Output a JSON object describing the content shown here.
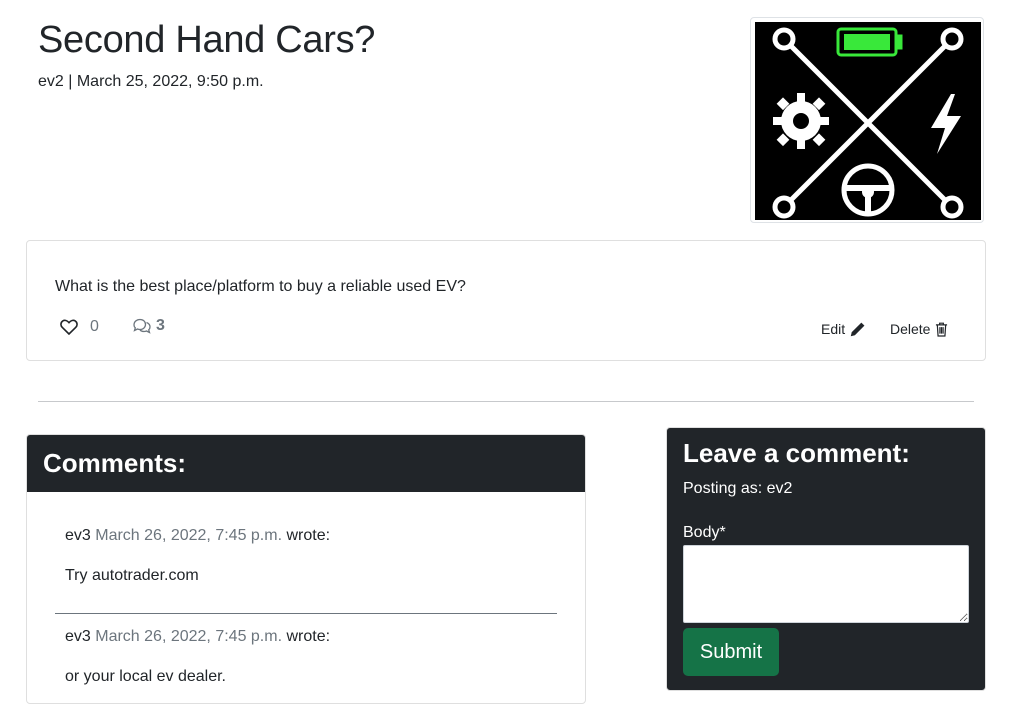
{
  "post": {
    "title": "Second Hand Cars?",
    "meta": "ev2 | March 25, 2022, 9:50 p.m.",
    "image_icon": "ev-crossed-lines-logo",
    "body": "What is the best place/platform to buy a reliable used EV?",
    "likes": "0",
    "comments_count": "3",
    "edit_label": "Edit",
    "delete_label": "Delete"
  },
  "comments": {
    "heading": "Comments:",
    "items": [
      {
        "author": "ev3",
        "date": "March 26, 2022, 7:45 p.m.",
        "suffix": "wrote:",
        "text": "Try autotrader.com"
      },
      {
        "author": "ev3",
        "date": "March 26, 2022, 7:45 p.m.",
        "suffix": "wrote:",
        "text": "or your local ev dealer."
      }
    ]
  },
  "form": {
    "title": "Leave a comment:",
    "posting_as": "Posting as: ev2",
    "body_label": "Body*",
    "submit_label": "Submit"
  },
  "colors": {
    "dark": "#212529",
    "muted": "#6c757d",
    "submit": "#157347",
    "battery_green": "#39e83a"
  }
}
